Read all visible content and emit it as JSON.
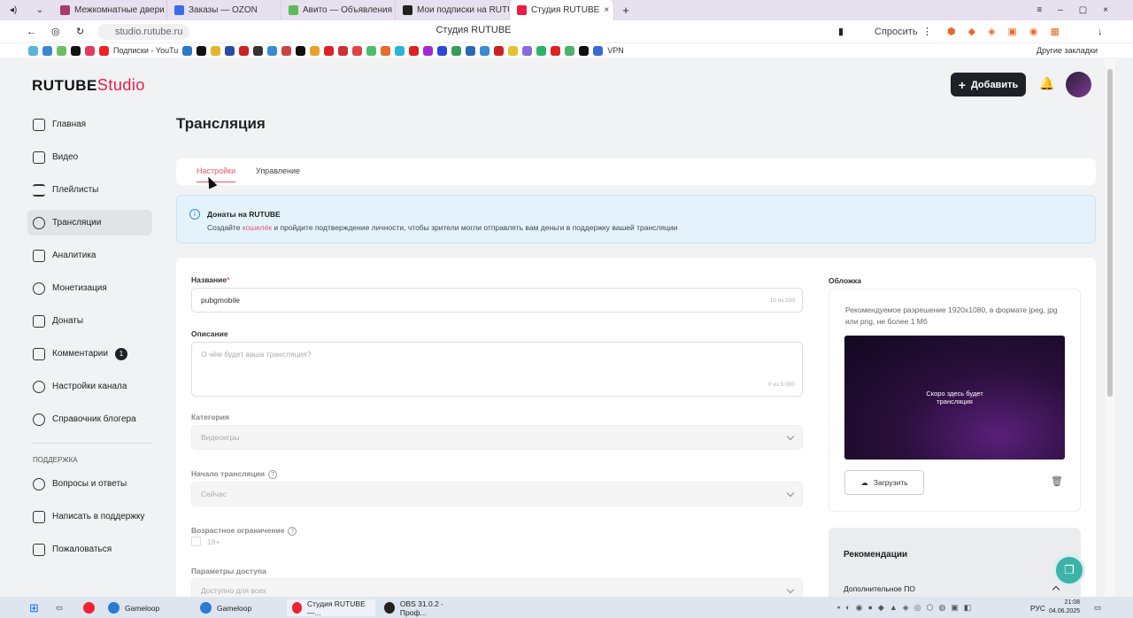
{
  "browser": {
    "tabs": [
      {
        "label": "Межкомнатные двери ко",
        "color": "#a83a6c"
      },
      {
        "label": "Заказы — OZON",
        "color": "#3b6be6"
      },
      {
        "label": "Авито — Объявления на",
        "color": "#5bbb5a"
      },
      {
        "label": "Мои подписки на RUTUB",
        "color": "#222222"
      },
      {
        "label": "Студия RUTUBE",
        "color": "#ed1b43"
      }
    ],
    "url": "studio.rutube.ru",
    "page_title": "Студия RUTUBE",
    "ask_label": "Спросить",
    "bookmarks_label": "Подписки - YouTu",
    "vpn_label": "VPN",
    "other_bookmarks": "Другие закладки"
  },
  "app": {
    "logo_main": "RUTUBE",
    "logo_studio": "Studio",
    "add_button": "Добавить"
  },
  "sidebar": {
    "items": [
      {
        "label": "Главная"
      },
      {
        "label": "Видео"
      },
      {
        "label": "Плейлисты"
      },
      {
        "label": "Трансляции"
      },
      {
        "label": "Аналитика"
      },
      {
        "label": "Монетизация"
      },
      {
        "label": "Донаты"
      },
      {
        "label": "Комментарии",
        "badge": "1"
      },
      {
        "label": "Настройки канала"
      },
      {
        "label": "Справочник блогера"
      }
    ],
    "support_title": "ПОДДЕРЖКА",
    "support_items": [
      {
        "label": "Вопросы и ответы"
      },
      {
        "label": "Написать в поддержку"
      },
      {
        "label": "Пожаловаться"
      }
    ]
  },
  "main": {
    "title": "Трансляция",
    "tabs": [
      {
        "label": "Настройки"
      },
      {
        "label": "Управление"
      }
    ],
    "info": {
      "title": "Донаты на RUTUBE",
      "body_pre": "Создайте ",
      "body_link": "кошелёк",
      "body_post": " и пройдите подтверждение личности, чтобы зрители могли отправлять вам деньги в поддержку вашей трансляции"
    },
    "form": {
      "name_label": "Название",
      "name_required": "*",
      "name_value": "pubgmobile",
      "name_counter": "10 из 100",
      "desc_label": "Описание",
      "desc_placeholder": "О чём будет ваша трансляция?",
      "desc_counter": "0 из 5 000",
      "category_label": "Категория",
      "category_value": "Видеоигры",
      "start_label": "Начало трансляции",
      "start_value": "Сейчас",
      "age_label": "Возрастное ограничение",
      "age_value": "18+",
      "access_label": "Параметры доступа",
      "access_value": "Доступно для всех"
    },
    "cover": {
      "label": "Обложка",
      "desc": "Рекомендуемое разрешение 1920x1080, в формате jpeg, jpg или png, не более 1 Мб",
      "preview_text": "Скоро здесь будет трансляция",
      "upload_label": "Загрузить"
    },
    "recs": {
      "title": "Рекомендации",
      "sub": "Дополнительное ПО"
    }
  },
  "taskbar": {
    "items": [
      {
        "label": "Gameloop"
      },
      {
        "label": "Gameloop"
      },
      {
        "label": "Студия RUTUBE —..."
      },
      {
        "label": "OBS 31.0.2 - Проф..."
      }
    ],
    "lang": "РУС",
    "time": "21:08",
    "date": "04.06.2025"
  }
}
